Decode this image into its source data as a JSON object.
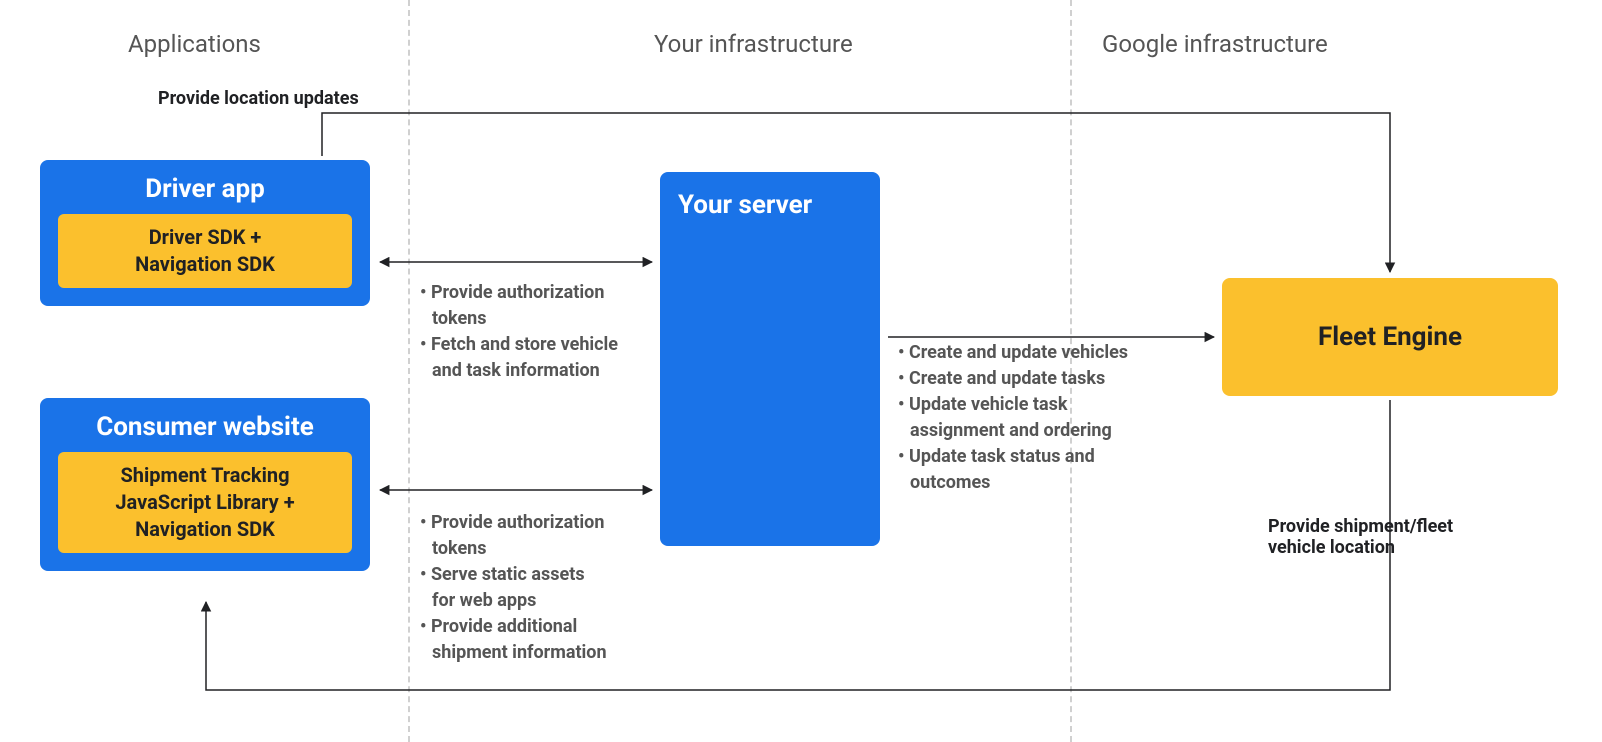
{
  "sections": {
    "applications": "Applications",
    "your_infra": "Your infrastructure",
    "google_infra": "Google infrastructure"
  },
  "driver_app": {
    "title": "Driver app",
    "inner": "Driver SDK +\nNavigation SDK"
  },
  "consumer_site": {
    "title": "Consumer website",
    "inner": "Shipment Tracking\nJavaScript Library  +\nNavigation SDK"
  },
  "server": {
    "title": "Your server"
  },
  "fleet_engine": {
    "title": "Fleet Engine"
  },
  "bullets_driver_server": [
    "Provide authorization",
    "tokens",
    "Fetch and store vehicle",
    "and task information"
  ],
  "bullets_driver_server_cont": [
    false,
    true,
    false,
    true
  ],
  "bullets_consumer_server": [
    "Provide authorization",
    "tokens",
    "Serve static assets",
    "for web apps",
    "Provide additional",
    "shipment information"
  ],
  "bullets_consumer_server_cont": [
    false,
    true,
    false,
    true,
    false,
    true
  ],
  "bullets_server_fleet": [
    "Create and update vehicles",
    "Create and update tasks",
    "Update vehicle task",
    "assignment and ordering",
    "Update task status and",
    "outcomes"
  ],
  "bullets_server_fleet_cont": [
    false,
    false,
    false,
    true,
    false,
    true
  ],
  "edges": {
    "top_label": "Provide location updates",
    "bottom_label": "Provide shipment/fleet\nvehicle location"
  }
}
